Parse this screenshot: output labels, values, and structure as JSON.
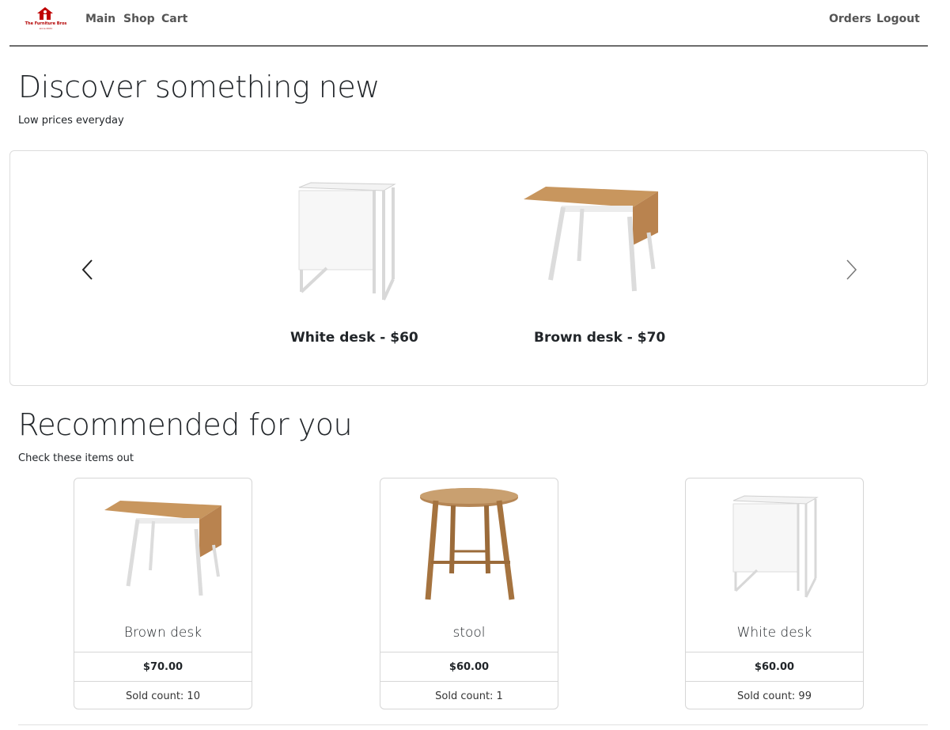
{
  "brand": {
    "name": "The Furniture Bros",
    "tagline": "since 2021",
    "color": "#b30000"
  },
  "nav": {
    "left": [
      {
        "label": "Main"
      },
      {
        "label": "Shop"
      },
      {
        "label": "Cart"
      }
    ],
    "right": [
      {
        "label": "Orders"
      },
      {
        "label": "Logout"
      }
    ]
  },
  "discover": {
    "title": "Discover something new",
    "subtitle": "Low prices everyday"
  },
  "carousel": {
    "slides": [
      {
        "caption": "White desk - $60",
        "image": "white-desk"
      },
      {
        "caption": "Brown desk - $70",
        "image": "brown-desk"
      }
    ],
    "prev_icon": "chevron-left-icon",
    "next_icon": "chevron-right-icon"
  },
  "recommended": {
    "title": "Recommended for you",
    "subtitle": "Check these items out",
    "items": [
      {
        "name": "Brown desk",
        "price": "$70.00",
        "sold": "Sold count: 10",
        "image": "brown-desk"
      },
      {
        "name": "stool",
        "price": "$60.00",
        "sold": "Sold count: 1",
        "image": "round-wooden-table"
      },
      {
        "name": "White desk",
        "price": "$60.00",
        "sold": "Sold count: 99",
        "image": "white-desk"
      }
    ]
  }
}
